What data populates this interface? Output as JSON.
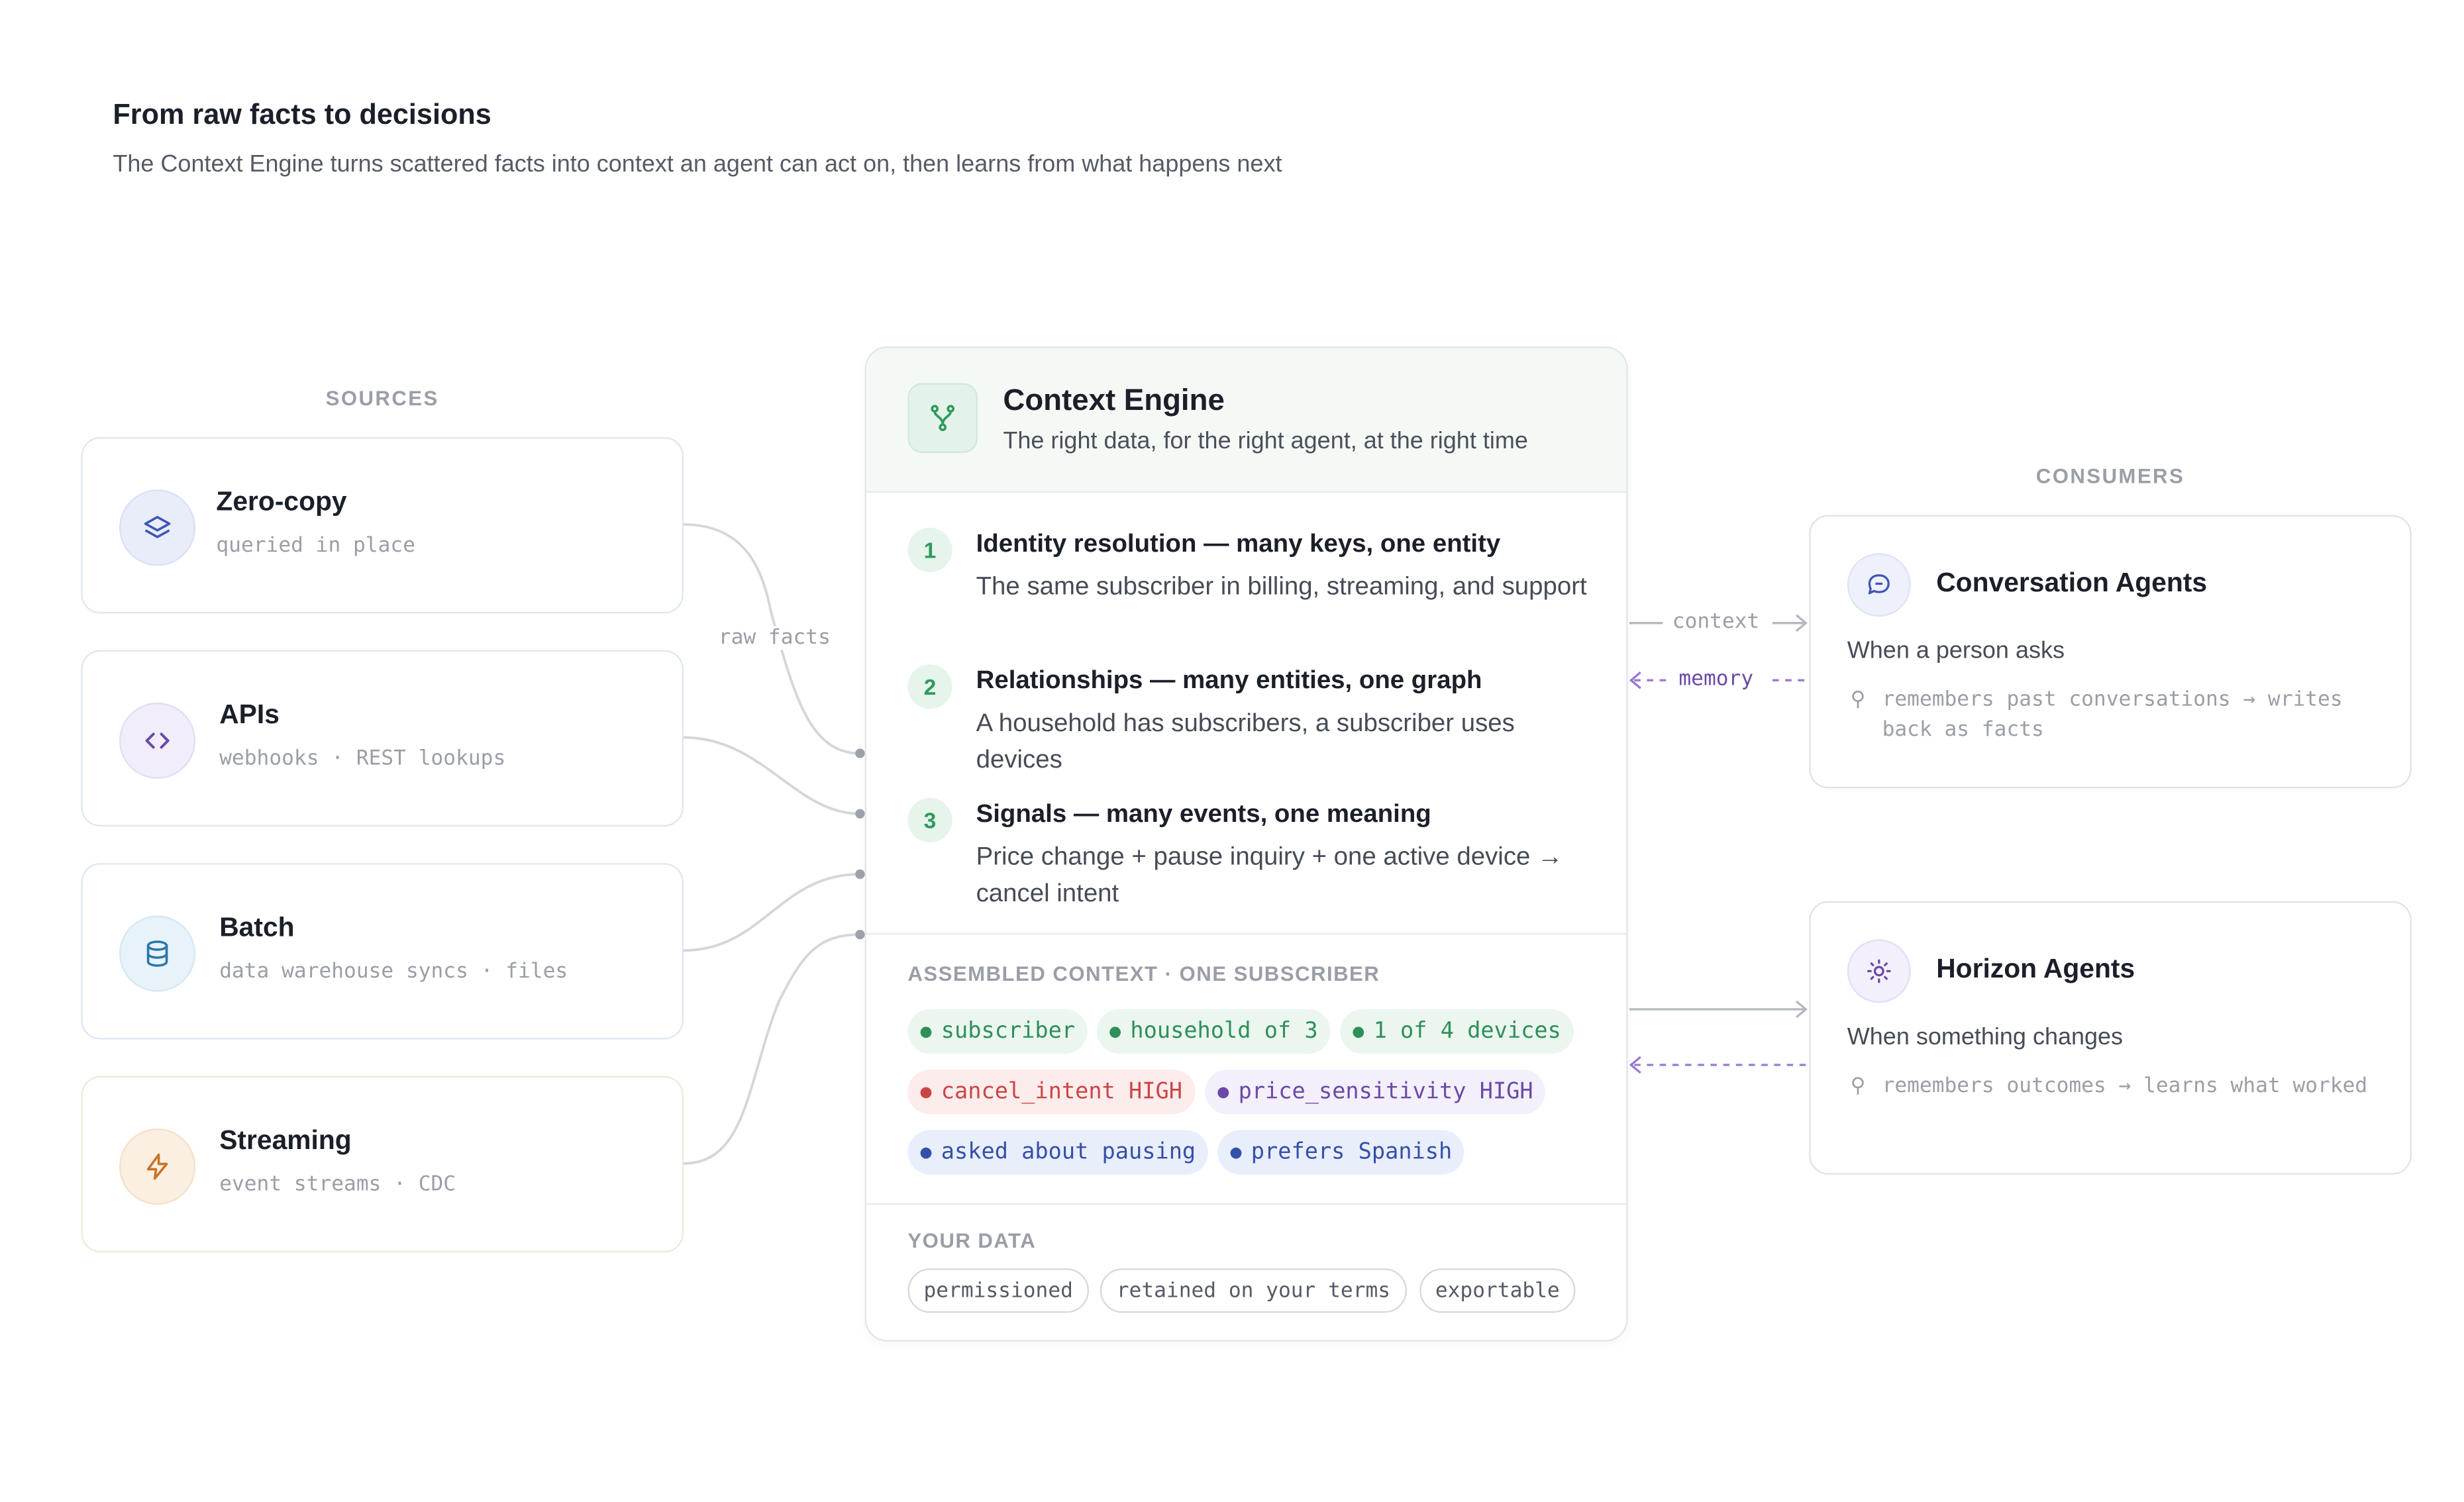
{
  "header": {
    "title": "From raw facts to decisions",
    "subtitle": "The Context Engine turns scattered facts into context an agent can act on, then learns from what happens next"
  },
  "sources": {
    "label": "SOURCES",
    "items": [
      {
        "title": "Zero-copy",
        "subtitle": "queried in place",
        "icon": "layers-icon",
        "color": "#3d57b5"
      },
      {
        "title": "APIs",
        "subtitle": "webhooks · REST lookups",
        "icon": "code-icon",
        "color": "#6b4aa6"
      },
      {
        "title": "Batch",
        "subtitle": "data warehouse syncs · files",
        "icon": "database-icon",
        "color": "#2c76a8"
      },
      {
        "title": "Streaming",
        "subtitle": "event streams · CDC",
        "icon": "lightning-icon",
        "color": "#c9742a"
      }
    ],
    "flow_label": "raw facts"
  },
  "engine": {
    "title": "Context Engine",
    "subtitle": "The right data, for the right agent, at the right time",
    "icon": "fork-icon",
    "steps": [
      {
        "num": "1",
        "title": "Identity resolution — many keys, one entity",
        "desc": "The same subscriber in billing, streaming, and support"
      },
      {
        "num": "2",
        "title": "Relationships — many entities, one graph",
        "desc": "A household has subscribers, a subscriber uses devices"
      },
      {
        "num": "3",
        "title": "Signals — many events, one meaning",
        "desc": "Price change + pause inquiry + one active device → cancel intent"
      }
    ],
    "assembled_label": "ASSEMBLED CONTEXT · ONE SUBSCRIBER",
    "chips": [
      {
        "text": "subscriber",
        "tone": "green"
      },
      {
        "text": "household of 3",
        "tone": "green"
      },
      {
        "text": "1 of 4 devices",
        "tone": "green"
      },
      {
        "text": "cancel_intent HIGH",
        "tone": "red"
      },
      {
        "text": "price_sensitivity HIGH",
        "tone": "purple"
      },
      {
        "text": "asked about pausing",
        "tone": "blue"
      },
      {
        "text": "prefers Spanish",
        "tone": "blue"
      }
    ],
    "your_data_label": "YOUR DATA",
    "pills": [
      "permissioned",
      "retained on your terms",
      "exportable"
    ]
  },
  "consumers": {
    "label": "CONSUMERS",
    "context_label": "context",
    "memory_label": "memory",
    "items": [
      {
        "title": "Conversation Agents",
        "subtitle": "When a person asks",
        "note": "remembers past conversations → writes back as facts",
        "icon": "chat-icon"
      },
      {
        "title": "Horizon Agents",
        "subtitle": "When something changes",
        "note": "remembers outcomes → learns what worked",
        "icon": "sun-icon"
      }
    ]
  },
  "colors": {
    "accent_green": "#2e9a5e",
    "memory_purple": "#8a63c9",
    "connector_gray": "#c9ccd2"
  }
}
